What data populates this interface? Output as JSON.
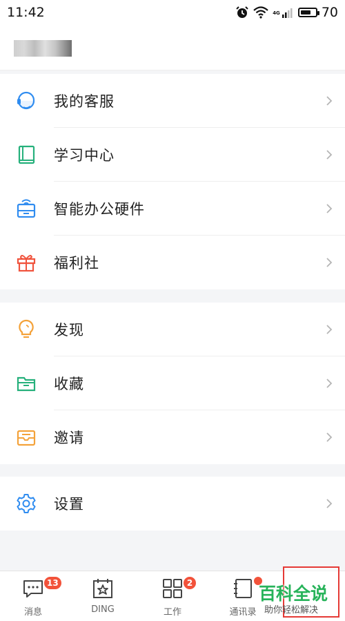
{
  "status_bar": {
    "time": "11:42",
    "network": "4G",
    "battery": "70",
    "battery_level": 0.7
  },
  "menu": {
    "group1": [
      {
        "label": "我的客服",
        "icon": "headset-icon",
        "color": "#2f8cf0"
      },
      {
        "label": "学习中心",
        "icon": "book-icon",
        "color": "#25b07b"
      },
      {
        "label": "智能办公硬件",
        "icon": "device-icon",
        "color": "#2f8cf0"
      },
      {
        "label": "福利社",
        "icon": "gift-icon",
        "color": "#f0533d"
      }
    ],
    "group2": [
      {
        "label": "发现",
        "icon": "lightbulb-icon",
        "color": "#f4a23a"
      },
      {
        "label": "收藏",
        "icon": "folder-icon",
        "color": "#25b07b"
      },
      {
        "label": "邀请",
        "icon": "envelope-icon",
        "color": "#f4a23a"
      }
    ],
    "group3": [
      {
        "label": "设置",
        "icon": "gear-icon",
        "color": "#2f8cf0"
      }
    ]
  },
  "tabbar": {
    "tabs": [
      {
        "label": "消息",
        "icon": "message-icon",
        "badge": "13"
      },
      {
        "label": "DING",
        "icon": "ding-icon",
        "badge": ""
      },
      {
        "label": "工作",
        "icon": "grid-icon",
        "badge": "2"
      },
      {
        "label": "通讯录",
        "icon": "contacts-icon",
        "badge": ""
      }
    ]
  },
  "watermark": {
    "title": "百科全说",
    "subtitle": "助你轻松解决"
  }
}
